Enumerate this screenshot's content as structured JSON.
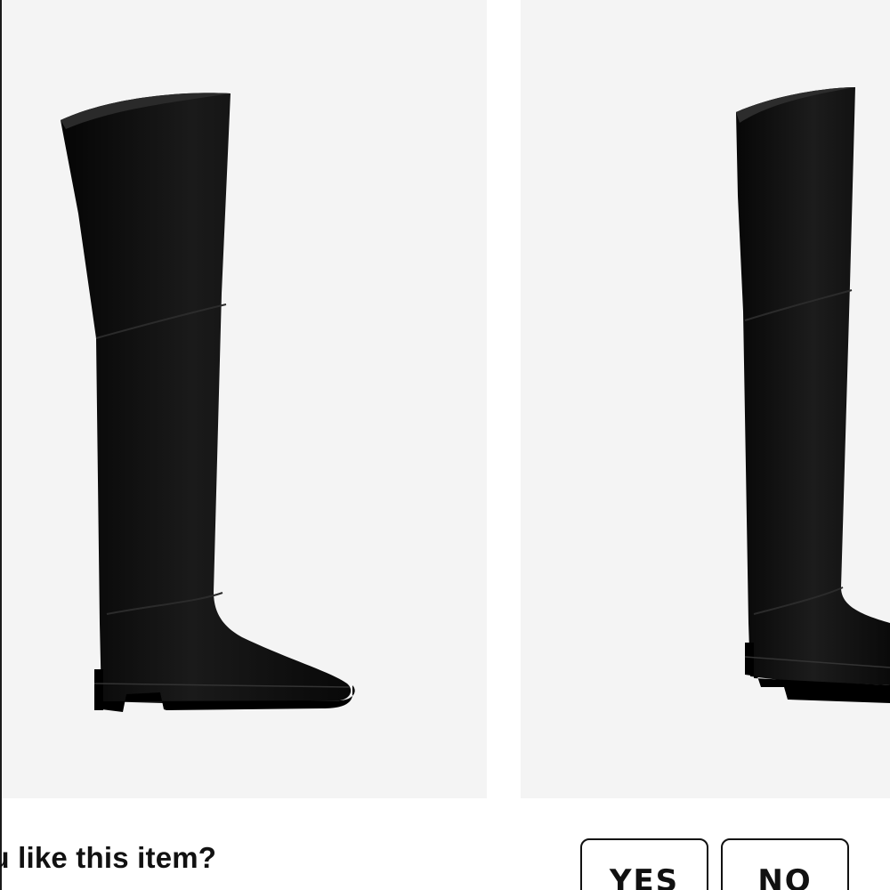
{
  "products": [
    {
      "alt": "Black leather over-the-knee flat boot, side view"
    },
    {
      "alt": "Black leather over-the-knee flat boot, angled view"
    }
  ],
  "feedback": {
    "question": "ou like this item?",
    "yes_label": "YES",
    "no_label": "NO"
  },
  "colors": {
    "image_background": "#f4f4f4",
    "boot": "#0d0d0d",
    "text": "#111111"
  }
}
